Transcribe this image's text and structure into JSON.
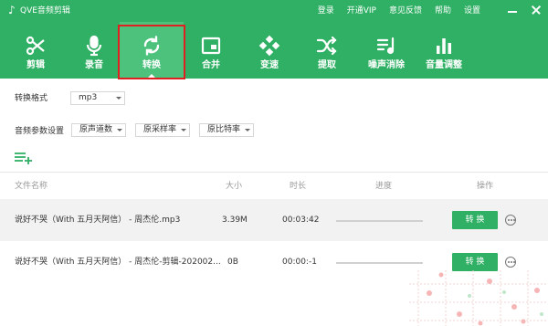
{
  "app": {
    "title": "QVE音频剪辑",
    "icon": "music-note-icon"
  },
  "top_links": [
    "登录",
    "开通VIP",
    "意见反馈",
    "帮助",
    "设置"
  ],
  "window_controls": [
    "minimize-icon",
    "close-icon"
  ],
  "toolbar": [
    {
      "label": "剪辑",
      "icon": "scissors-icon",
      "active": false
    },
    {
      "label": "录音",
      "icon": "microphone-icon",
      "active": false
    },
    {
      "label": "转换",
      "icon": "convert-arrows-icon",
      "active": true
    },
    {
      "label": "合并",
      "icon": "merge-icon",
      "active": false
    },
    {
      "label": "变速",
      "icon": "speed-icon",
      "active": false
    },
    {
      "label": "提取",
      "icon": "shuffle-extract-icon",
      "active": false
    },
    {
      "label": "噪声消除",
      "icon": "noise-removal-icon",
      "active": false
    },
    {
      "label": "音量调整",
      "icon": "volume-bars-icon",
      "active": false
    }
  ],
  "settings": {
    "format_label": "转换格式",
    "format_value": "mp3",
    "params_label": "音频参数设置",
    "channels_value": "原声道数",
    "samplerate_value": "原采样率",
    "bitrate_value": "原比特率"
  },
  "table": {
    "headers": {
      "name": "文件名称",
      "size": "大小",
      "duration": "时长",
      "progress": "进度",
      "action": "操作"
    },
    "rows": [
      {
        "name": "说好不哭（With 五月天阿信） - 周杰伦.mp3",
        "size": "3.39M",
        "duration": "00:03:42",
        "progress": 0,
        "button": "转 换"
      },
      {
        "name": "说好不哭（With 五月天阿信） - 周杰伦-剪辑-202002...",
        "size": "0B",
        "duration": "00:00:-1",
        "progress": 0,
        "button": "转 换"
      }
    ]
  },
  "colors": {
    "brand": "#2fb064",
    "active_tab": "#4cc27d",
    "highlight": "#e02020"
  }
}
